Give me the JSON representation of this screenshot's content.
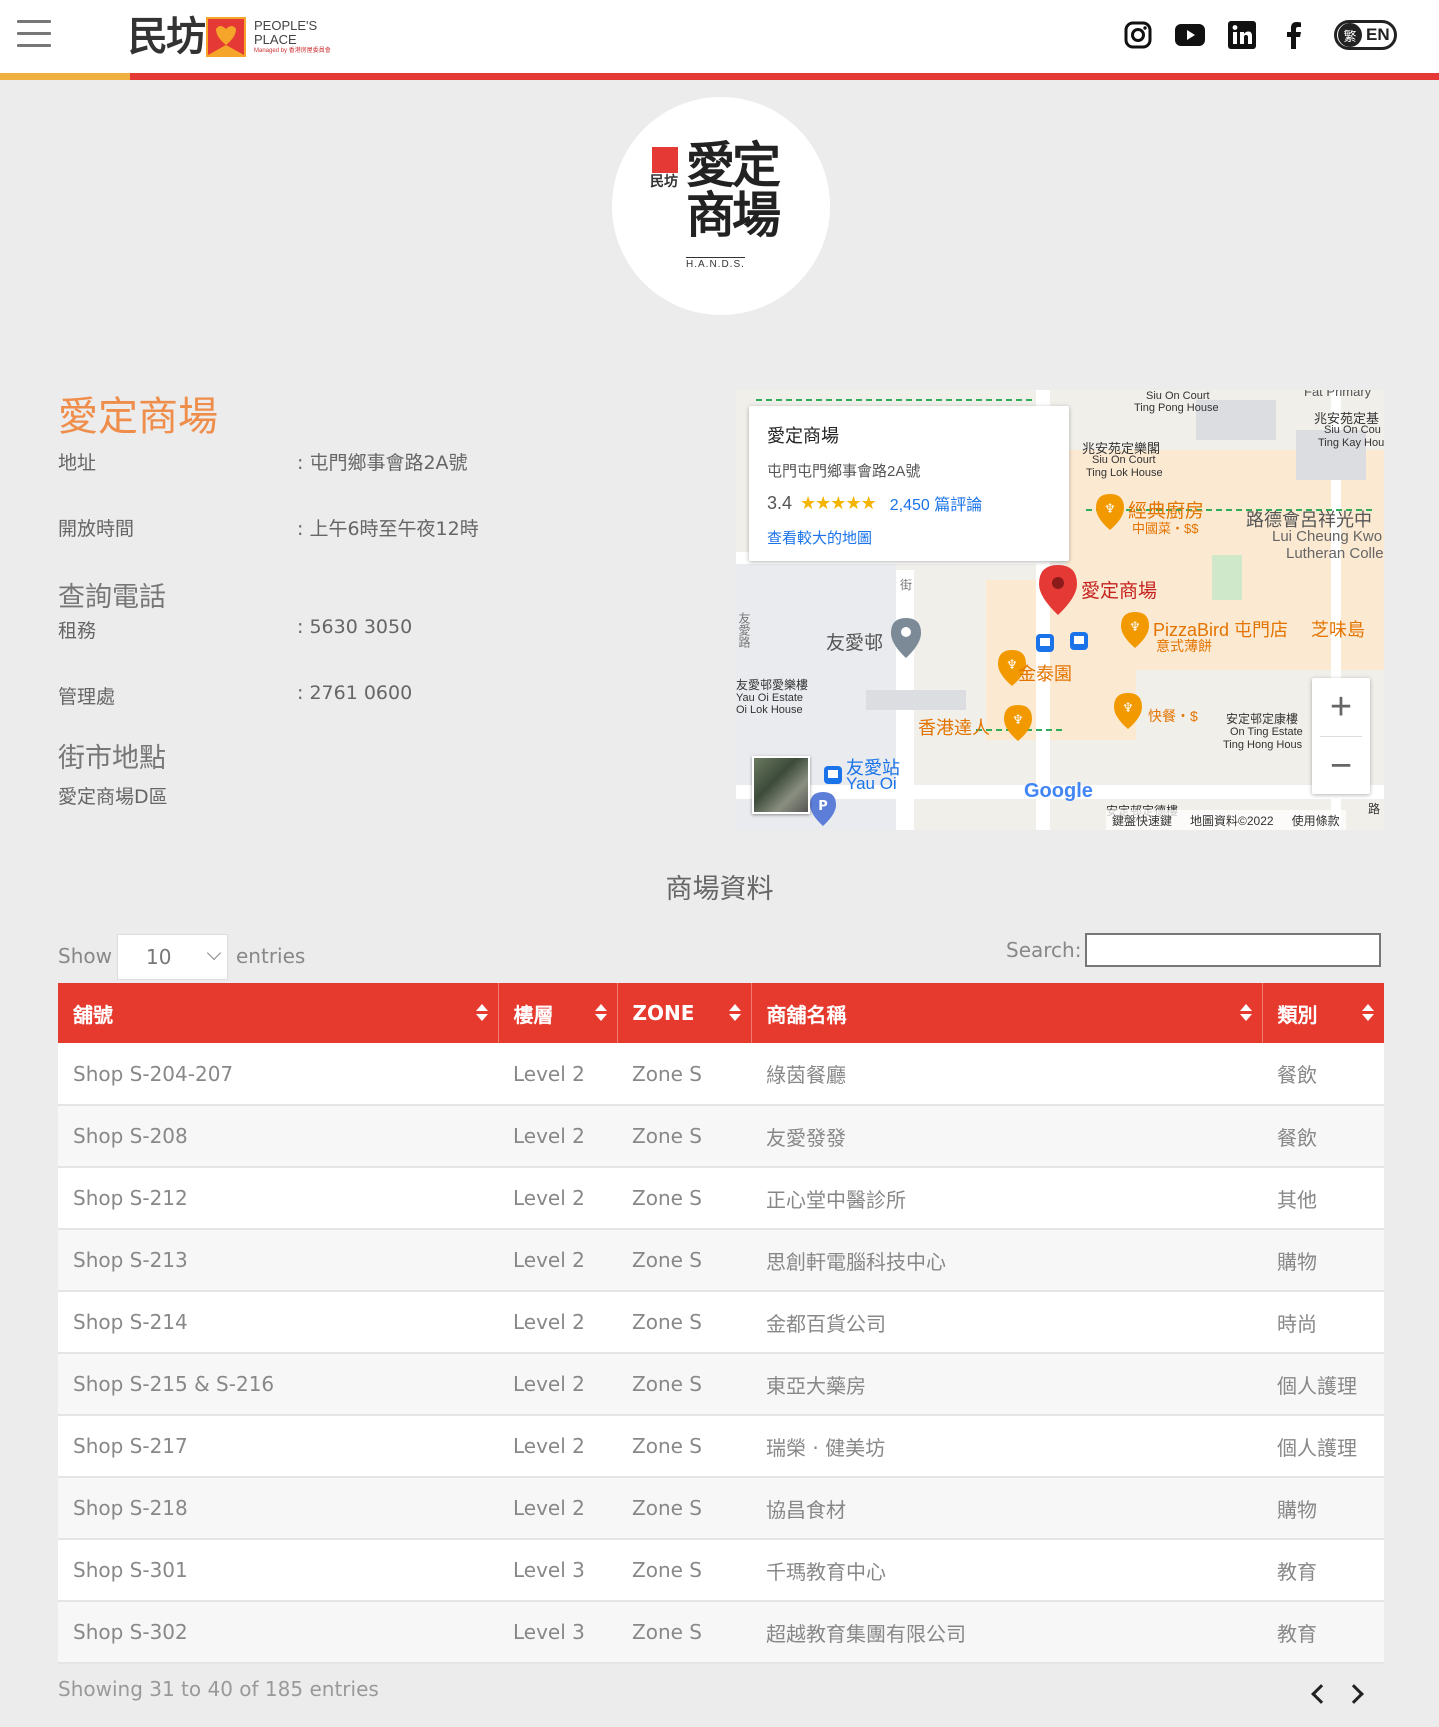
{
  "header": {
    "logo_cn": "民坊",
    "logo_en_line1": "PEOPLE'S",
    "logo_en_line2": "PLACE",
    "logo_en_small": "Managed by 香港房屋委員會",
    "lang_zh": "繁",
    "lang_en": "EN",
    "accent_color": "#e53935"
  },
  "mall_logo": {
    "small": "民坊",
    "line1": "愛定",
    "line2": "商場",
    "hands": "H.A.N.D.S."
  },
  "info": {
    "title": "愛定商場",
    "address_label": "地址",
    "address_value": ": 屯門鄉事會路2A號",
    "hours_label": "開放時間",
    "hours_value": ": 上午6時至午夜12時",
    "enquiry_heading": "查詢電話",
    "leasing_label": "租務",
    "leasing_value": ": 5630 3050",
    "mgmt_label": "管理處",
    "mgmt_value": ": 2761 0600",
    "market_heading": "街市地點",
    "market_value": "愛定商場D區"
  },
  "map": {
    "card_title": "愛定商場",
    "card_address": "屯門屯門鄉事會路2A號",
    "rating": "3.4",
    "stars": "★★★★★",
    "reviews": "2,450 篇評論",
    "larger_map": "查看較大的地圖",
    "zoom_in": "+",
    "zoom_out": "−",
    "footer_shortcuts": "鍵盤快速鍵",
    "footer_data": "地圖資料©2022",
    "footer_terms": "使用條款",
    "google": "Google",
    "labels": {
      "pin_main": "愛定商場",
      "classic_kitchen": "經典廚房",
      "classic_kitchen_sub": "中國菜・$$",
      "pizzabird": "PizzaBird 屯門店",
      "pizzabird_sub": "意式薄餅",
      "chiweidao": "芝味島",
      "yauoi_estate": "友愛邨",
      "kamtai": "金泰園",
      "hk_talent": "香港達人",
      "fast_food": "快餐・$",
      "yau_oi_station": "友愛站",
      "yau_oi_station_en": "Yau Oi",
      "lutheran": "路德會呂祥光中",
      "lutheran_en1": "Lui Cheung Kwo",
      "lutheran_en2": "Lutheran Colle",
      "siu_on_court": "Siu On Court",
      "ting_pong_house": "Ting Pong House",
      "siu_on_court_ting_lok": "兆安苑定樂閣",
      "siu_on_court_2": "Siu On Court",
      "ting_lok_house": "Ting Lok House",
      "siu_on_right": "兆安苑定基",
      "siu_on_right_2": "Siu On Cou",
      "ting_kay": "Ting Kay Hou",
      "fat_primary": "Fat Primary",
      "on_ting": "安定邨定康樓",
      "on_ting_en": "On Ting Estate",
      "ting_hong": "Ting Hong Hous",
      "yauoi_lok": "友愛邨愛樂樓",
      "yauoi_lok_en1": "Yau Oi Estate",
      "yauoi_lok_en2": "Oi Lok House",
      "on_ting_bottom": "安定邨定德樓",
      "road_right": "路",
      "road_left": "友愛路",
      "road_mid": "街"
    }
  },
  "table_section": {
    "title": "商場資料",
    "show_label": "Show",
    "entries_value": "10",
    "entries_label": "entries",
    "search_label": "Search:",
    "search_value": "",
    "columns": [
      "舖號",
      "樓層",
      "ZONE",
      "商舖名稱",
      "類別"
    ],
    "rows": [
      [
        "Shop S-204-207",
        "Level 2",
        "Zone S",
        "綠茵餐廳",
        "餐飲"
      ],
      [
        "Shop S-208",
        "Level 2",
        "Zone S",
        "友愛發發",
        "餐飲"
      ],
      [
        "Shop S-212",
        "Level 2",
        "Zone S",
        "正心堂中醫診所",
        "其他"
      ],
      [
        "Shop S-213",
        "Level 2",
        "Zone S",
        "思創軒電腦科技中心",
        "購物"
      ],
      [
        "Shop S-214",
        "Level 2",
        "Zone S",
        "金都百貨公司",
        "時尚"
      ],
      [
        "Shop S-215 & S-216",
        "Level 2",
        "Zone S",
        "東亞大藥房",
        "個人護理"
      ],
      [
        "Shop S-217",
        "Level 2",
        "Zone S",
        "瑞榮 · 健美坊",
        "個人護理"
      ],
      [
        "Shop S-218",
        "Level 2",
        "Zone S",
        "協昌食材",
        "購物"
      ],
      [
        "Shop S-301",
        "Level 3",
        "Zone S",
        "千瑪教育中心",
        "教育"
      ],
      [
        "Shop S-302",
        "Level 3",
        "Zone S",
        "超越教育集團有限公司",
        "教育"
      ]
    ],
    "info": "Showing 31 to 40 of 185 entries"
  }
}
